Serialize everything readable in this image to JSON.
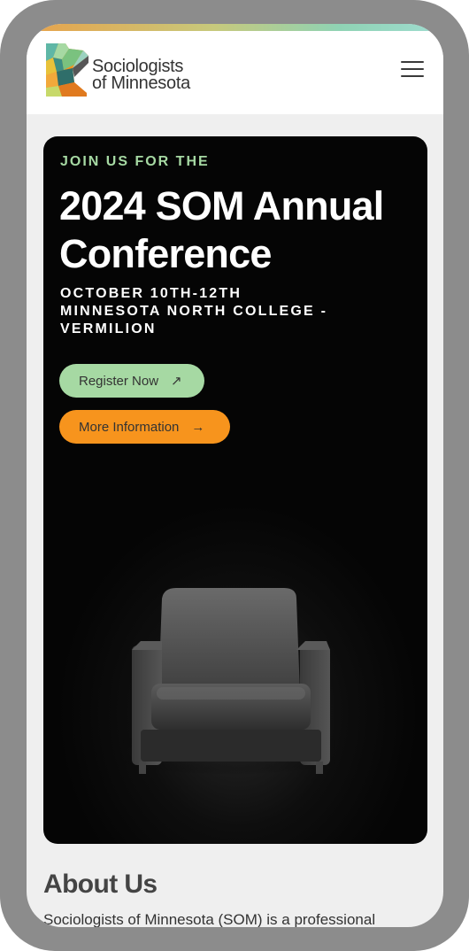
{
  "brand": {
    "name_line1": "Sociologists",
    "name_line2": "of Minnesota",
    "logo_icon": "minnesota-map-mosaic-icon",
    "menu_icon": "hamburger-menu-icon"
  },
  "hero": {
    "eyebrow": "JOIN US FOR THE",
    "title": "2024 SOM Annual Conference",
    "date": "OCTOBER 10TH-12TH",
    "location_line1": "MINNESOTA NORTH COLLEGE -",
    "location_line2": "VERMILION",
    "register_label": "Register Now",
    "register_icon": "arrow-up-right-icon",
    "info_label": "More Information",
    "info_icon": "arrow-right-icon",
    "image": "armchair-spotlight"
  },
  "about": {
    "title": "About Us",
    "text": "Sociologists of Minnesota (SOM) is a professional"
  },
  "colors": {
    "frame": "#8c8c8c",
    "hero_bg": "#050505",
    "accent_green": "#a6d9a3",
    "accent_orange": "#f7941d",
    "page_bg": "#efefef"
  }
}
